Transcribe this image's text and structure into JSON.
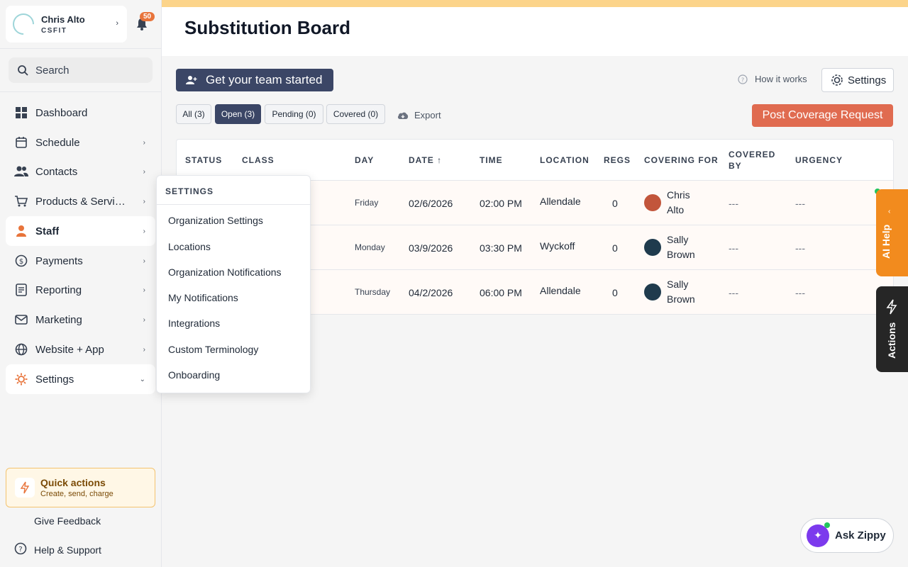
{
  "user": {
    "name": "Chris Alto",
    "org": "CSFIT",
    "notification_count": "50"
  },
  "search": {
    "placeholder": "Search"
  },
  "sidebar": {
    "items": [
      {
        "label": "Dashboard"
      },
      {
        "label": "Schedule"
      },
      {
        "label": "Contacts"
      },
      {
        "label": "Products & Services"
      },
      {
        "label": "Staff"
      },
      {
        "label": "Payments"
      },
      {
        "label": "Reporting"
      },
      {
        "label": "Marketing"
      },
      {
        "label": "Website + App"
      },
      {
        "label": "Settings"
      }
    ],
    "quick_actions": {
      "title": "Quick actions",
      "subtitle": "Create, send, charge"
    },
    "feedback": "Give Feedback",
    "help": "Help & Support"
  },
  "page": {
    "title": "Substitution Board"
  },
  "toolbar": {
    "team_button": "Get your team started",
    "how_it_works": "How it works",
    "settings_button": "Settings",
    "export": "Export",
    "post_button": "Post Coverage Request"
  },
  "filters": [
    "All (3)",
    "Open (3)",
    "Pending (0)",
    "Covered (0)"
  ],
  "table": {
    "headers": [
      "STATUS",
      "CLASS",
      "DAY",
      "DATE ↑",
      "TIME",
      "LOCATION",
      "REGS",
      "COVERING FOR",
      "COVERED BY",
      "URGENCY"
    ],
    "rows": [
      {
        "day": "Friday",
        "date": "02/6/2026",
        "time": "02:00 PM",
        "location": "Allendale",
        "regs": "0",
        "covering_first": "Chris",
        "covering_last": "Alto",
        "covered_by": "---",
        "urgency": "---"
      },
      {
        "day": "Monday",
        "date": "03/9/2026",
        "time": "03:30 PM",
        "location": "Wyckoff",
        "regs": "0",
        "covering_first": "Sally",
        "covering_last": "Brown",
        "covered_by": "---",
        "urgency": "---"
      },
      {
        "day": "Thursday",
        "date": "04/2/2026",
        "time": "06:00 PM",
        "location": "Allendale",
        "regs": "0",
        "covering_first": "Sally",
        "covering_last": "Brown",
        "covered_by": "---",
        "urgency": "---"
      }
    ]
  },
  "settings_menu": {
    "title": "SETTINGS",
    "items": [
      "Organization Settings",
      "Locations",
      "Organization Notifications",
      "My Notifications",
      "Integrations",
      "Custom Terminology",
      "Onboarding"
    ]
  },
  "side_tabs": {
    "ai_help": "AI Help",
    "actions": "Actions"
  },
  "zippy": {
    "label": "Ask Zippy"
  },
  "colors": {
    "accent_orange": "#e8743b",
    "primary_navy": "#3b4666",
    "post_button": "#e06b50",
    "ai_tab": "#f28b1e"
  }
}
